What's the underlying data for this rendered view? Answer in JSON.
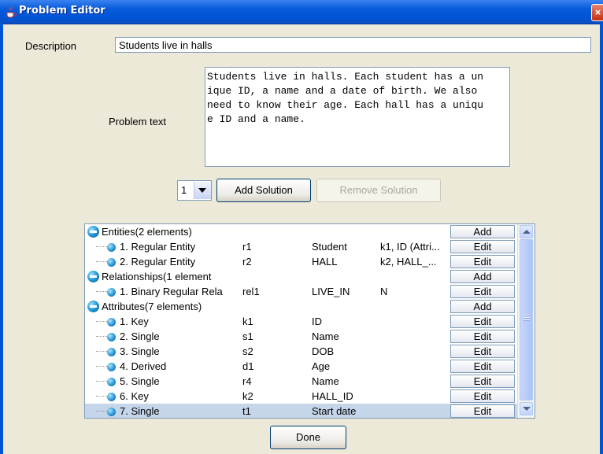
{
  "window": {
    "title": "Problem Editor",
    "close_label": "×"
  },
  "description": {
    "label": "Description",
    "value": "Students live in halls"
  },
  "problem_text": {
    "label": "Problem text",
    "value": "Students live in halls. Each student has a un\nique ID, a name and a date of birth. We also\nneed to know their age. Each hall has a uniqu\ne ID and a name."
  },
  "solution": {
    "selected": "1",
    "add_label": "Add Solution",
    "remove_label": "Remove Solution"
  },
  "tree": {
    "groups": [
      {
        "label": "Entities(2 elements)",
        "button": "Add"
      },
      {
        "label": "Relationships(1 element",
        "button": "Add"
      },
      {
        "label": "Attributes(7 elements)",
        "button": "Add"
      }
    ],
    "rows": [
      {
        "type": "1. Regular Entity",
        "id": "r1",
        "name": "Student",
        "extra": "k1, ID (Attri...",
        "button": "Edit"
      },
      {
        "type": "2. Regular Entity",
        "id": "r2",
        "name": "HALL",
        "extra": "k2, HALL_...",
        "button": "Edit"
      },
      {
        "type": "1. Binary Regular Rela",
        "id": "rel1",
        "name": "LIVE_IN",
        "extra": "N",
        "button": "Edit"
      },
      {
        "type": "1. Key",
        "id": "k1",
        "name": "ID",
        "extra": "",
        "button": "Edit"
      },
      {
        "type": "2. Single",
        "id": "s1",
        "name": "Name",
        "extra": "",
        "button": "Edit"
      },
      {
        "type": "3. Single",
        "id": "s2",
        "name": "DOB",
        "extra": "",
        "button": "Edit"
      },
      {
        "type": "4. Derived",
        "id": "d1",
        "name": "Age",
        "extra": "",
        "button": "Edit"
      },
      {
        "type": "5. Single",
        "id": "r4",
        "name": "Name",
        "extra": "",
        "button": "Edit"
      },
      {
        "type": "6. Key",
        "id": "k2",
        "name": "HALL_ID",
        "extra": "",
        "button": "Edit"
      },
      {
        "type": "7. Single",
        "id": "t1",
        "name": "Start date",
        "extra": "",
        "button": "Edit"
      }
    ]
  },
  "footer": {
    "done_label": "Done"
  },
  "colors": {
    "title_bar": "#0054d6",
    "dialog_bg": "#ece9d8",
    "selection": "#c5d6ea"
  }
}
